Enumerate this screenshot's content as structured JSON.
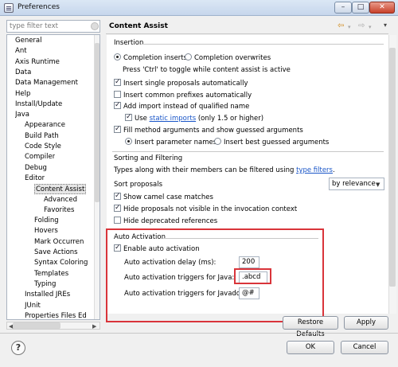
{
  "window": {
    "title": "Preferences"
  },
  "filter": {
    "placeholder": "type filter text"
  },
  "tree": {
    "items": [
      "General",
      "Ant",
      "Axis Runtime",
      "Data",
      "Data Management",
      "Help",
      "Install/Update",
      "Java",
      "Appearance",
      "Build Path",
      "Code Style",
      "Compiler",
      "Debug",
      "Editor",
      "Content Assist",
      "Advanced",
      "Favorites",
      "Folding",
      "Hovers",
      "Mark Occurren",
      "Save Actions",
      "Syntax Coloring",
      "Templates",
      "Typing",
      "Installed JREs",
      "JUnit",
      "Properties Files Ed"
    ],
    "selected": "Content Assist"
  },
  "page": {
    "title": "Content Assist",
    "insertion": {
      "heading": "Insertion",
      "completion_inserts": "Completion inserts",
      "completion_overwrites": "Completion overwrites",
      "hint": "Press 'Ctrl' to toggle while content assist is active",
      "single_proposals": "Insert single proposals automatically",
      "common_prefixes": "Insert common prefixes automatically",
      "add_import": "Add import instead of qualified name",
      "use": "Use",
      "static_imports": "static imports",
      "only_15": "(only 1.5 or higher)",
      "fill_method": "Fill method arguments and show guessed arguments",
      "insert_param_names": "Insert parameter names",
      "insert_best_guessed": "Insert best guessed arguments"
    },
    "sorting": {
      "heading": "Sorting and Filtering",
      "types_text": "Types along with their members can be filtered using",
      "type_filters": "type filters",
      "period": ".",
      "sort_proposals": "Sort proposals",
      "sort_value": "by relevance",
      "camel_case": "Show camel case matches",
      "hide_invisible": "Hide proposals not visible in the invocation context",
      "hide_deprecated": "Hide deprecated references"
    },
    "auto": {
      "heading": "Auto Activation",
      "enable": "Enable auto activation",
      "delay_label": "Auto activation delay (ms):",
      "delay_value": "200",
      "java_label": "Auto activation triggers for Java:",
      "java_value": ".abcd",
      "javadoc_label": "Auto activation triggers for Javadoc:",
      "javadoc_value": "@#"
    },
    "buttons": {
      "restore": "Restore Defaults",
      "apply": "Apply"
    }
  },
  "footer": {
    "ok": "OK",
    "cancel": "Cancel",
    "help": "?"
  },
  "colors": {
    "highlight": "#d9343a",
    "link": "#1a56c8"
  }
}
